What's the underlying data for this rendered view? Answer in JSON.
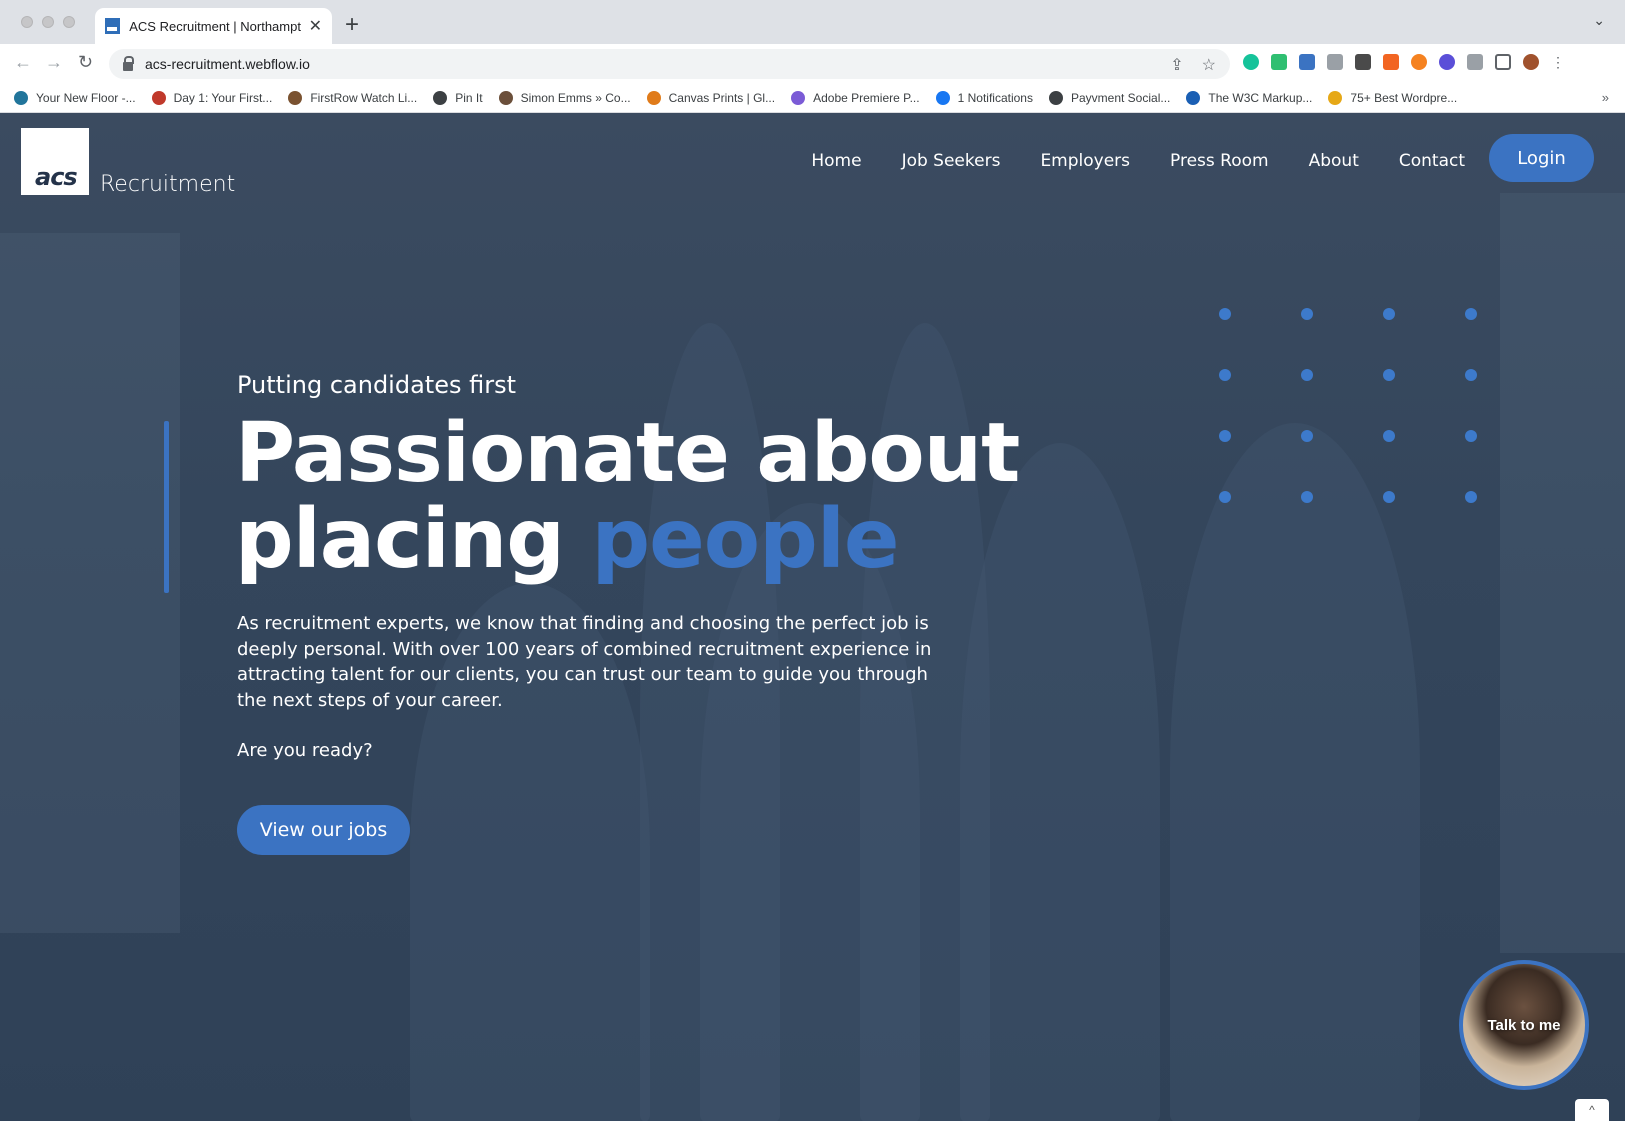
{
  "browser": {
    "tab_title": "ACS Recruitment | Northampto",
    "tab_close": "✕",
    "new_tab": "+",
    "url": "acs-recruitment.webflow.io",
    "bookmarks": [
      {
        "label": "Your New Floor -...",
        "color": "#21759b"
      },
      {
        "label": "Day 1: Your First...",
        "color": "#c0392b"
      },
      {
        "label": "FirstRow Watch Li...",
        "color": "#7a5230"
      },
      {
        "label": "Pin It",
        "color": "#3c4043"
      },
      {
        "label": "Simon Emms » Co...",
        "color": "#6b4f3a"
      },
      {
        "label": "Canvas Prints | Gl...",
        "color": "#e07b1a"
      },
      {
        "label": "Adobe Premiere P...",
        "color": "#7b5bd6"
      },
      {
        "label": "1 Notifications",
        "color": "#1877f2"
      },
      {
        "label": "Payvment Social...",
        "color": "#3c4043"
      },
      {
        "label": "The W3C Markup...",
        "color": "#1a5fb4"
      },
      {
        "label": "75+ Best Wordpre...",
        "color": "#e6a817"
      }
    ],
    "bookmarks_more": "»"
  },
  "site": {
    "logo_mark": "acs",
    "logo_text": "Recruitment",
    "nav": [
      "Home",
      "Job Seekers",
      "Employers",
      "Press Room",
      "About",
      "Contact"
    ],
    "login_label": "Login",
    "tagline": "Putting candidates first",
    "headline_line1": "Passionate about",
    "headline_line2_plain": "placing ",
    "headline_line2_accent": "people",
    "body": "As recruitment experts, we know that finding and choosing the perfect job is deeply personal. With over 100 years of combined recruitment experience in attracting talent for our clients, you can trust our team to guide you through the next steps of your career.",
    "ready": "Are you ready?",
    "cta_label": "View our jobs",
    "talk_label": "Talk to me",
    "scroll_top": "^",
    "accent_color": "#3b73c2"
  }
}
